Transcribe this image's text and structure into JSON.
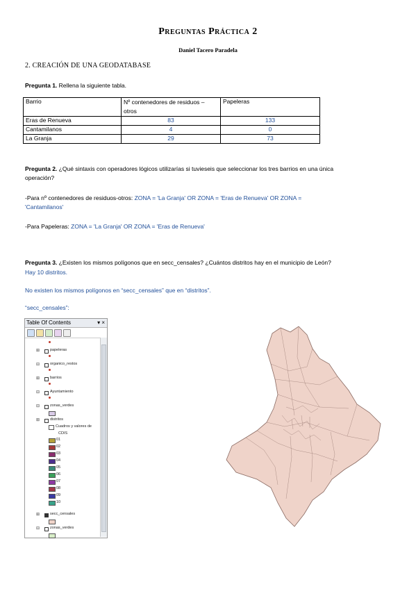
{
  "doc": {
    "title": "Preguntas Práctica 2",
    "author": "Daniel Tacero Paradela",
    "section": "2. CREACIÓN DE UNA GEODATABASE"
  },
  "q1": {
    "label": "Pregunta 1.",
    "text": " Rellena la siguiente tabla.",
    "table": {
      "headers": [
        "Barrio",
        "Nº contenedores de residuos – otros",
        "Papeleras"
      ],
      "rows": [
        [
          "Eras de Renueva",
          "83",
          "133"
        ],
        [
          "Cantamilanos",
          "4",
          "0"
        ],
        [
          "La Granja",
          "29",
          "73"
        ]
      ]
    }
  },
  "q2": {
    "label": "Pregunta 2.",
    "text_line1": " ¿Qué sintaxis con operadores lógicos utilizarías si tuvieseis que seleccionar los tres barrios en una única",
    "text_line2": "operación?",
    "a1_label": "-Para nº contenedores de residuos-otros: ",
    "a1_value_line1": "ZONA = 'La Granja' OR ZONA = 'Eras de Renueva' OR ZONA =",
    "a1_value_line2": "'Cantamilanos'",
    "a2_label": "-Para Papeleras: ",
    "a2_value": "ZONA = 'La Granja' OR ZONA = 'Eras de Renueva'"
  },
  "q3": {
    "label": "Pregunta 3.",
    "text": " ¿Existen los mismos polígonos que en secc_censales? ¿Cuántos distritos hay en el municipio de León?",
    "a1": "Hay 10 distritos.",
    "a2": "No existen los mismos polígonos en “secc_censales” que en “distritos”.",
    "a3": "“secc_censales”:"
  },
  "toc": {
    "title": "Table Of Contents",
    "controls": "▾ ×",
    "layers": [
      {
        "name": "papeleras"
      },
      {
        "name": "organico_restos"
      },
      {
        "name": "barrios"
      },
      {
        "name": "Ayuntamiento"
      },
      {
        "name": "zonas_verdes"
      },
      {
        "name": "distritos"
      },
      {
        "name": "secc_censales"
      },
      {
        "name": "zonas_verdes"
      }
    ],
    "distritos_field": "Cuadros y valores de",
    "distritos_field2": "CDIS",
    "classes": [
      "01",
      "02",
      "03",
      "04",
      "05",
      "06",
      "07",
      "08",
      "09",
      "10"
    ],
    "class_colors": [
      "#b5a23a",
      "#a33a3a",
      "#8a2f6e",
      "#4c2f8f",
      "#3a8a7a",
      "#3aa05a",
      "#8f3aa3",
      "#a3384a",
      "#3a3aa3",
      "#38a38a"
    ],
    "secc_color": "#efd3c9",
    "zonas_color": "#d8eec8",
    "zonas1_color": "#d9cbe8"
  },
  "map": {
    "fill": "#efd3c9",
    "stroke": "#8a6a62"
  }
}
